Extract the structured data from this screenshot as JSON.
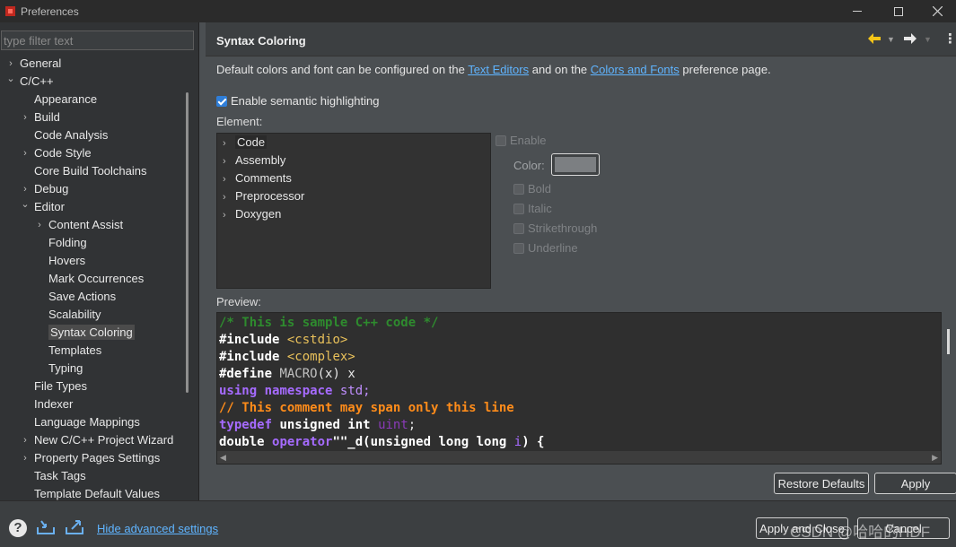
{
  "window": {
    "title": "Preferences"
  },
  "filter": {
    "placeholder": "type filter text"
  },
  "tree": [
    {
      "label": "General",
      "level": 0,
      "arrow": "right"
    },
    {
      "label": "C/C++",
      "level": 0,
      "arrow": "down"
    },
    {
      "label": "Appearance",
      "level": 1,
      "arrow": ""
    },
    {
      "label": "Build",
      "level": 1,
      "arrow": "right"
    },
    {
      "label": "Code Analysis",
      "level": 1,
      "arrow": ""
    },
    {
      "label": "Code Style",
      "level": 1,
      "arrow": "right"
    },
    {
      "label": "Core Build Toolchains",
      "level": 1,
      "arrow": ""
    },
    {
      "label": "Debug",
      "level": 1,
      "arrow": "right"
    },
    {
      "label": "Editor",
      "level": 1,
      "arrow": "down"
    },
    {
      "label": "Content Assist",
      "level": 2,
      "arrow": "right"
    },
    {
      "label": "Folding",
      "level": 2,
      "arrow": ""
    },
    {
      "label": "Hovers",
      "level": 2,
      "arrow": ""
    },
    {
      "label": "Mark Occurrences",
      "level": 2,
      "arrow": ""
    },
    {
      "label": "Save Actions",
      "level": 2,
      "arrow": ""
    },
    {
      "label": "Scalability",
      "level": 2,
      "arrow": ""
    },
    {
      "label": "Syntax Coloring",
      "level": 2,
      "arrow": "",
      "selected": true
    },
    {
      "label": "Templates",
      "level": 2,
      "arrow": ""
    },
    {
      "label": "Typing",
      "level": 2,
      "arrow": ""
    },
    {
      "label": "File Types",
      "level": 1,
      "arrow": ""
    },
    {
      "label": "Indexer",
      "level": 1,
      "arrow": ""
    },
    {
      "label": "Language Mappings",
      "level": 1,
      "arrow": ""
    },
    {
      "label": "New C/C++ Project Wizard",
      "level": 1,
      "arrow": "right"
    },
    {
      "label": "Property Pages Settings",
      "level": 1,
      "arrow": "right"
    },
    {
      "label": "Task Tags",
      "level": 1,
      "arrow": ""
    },
    {
      "label": "Template Default Values",
      "level": 1,
      "arrow": ""
    }
  ],
  "page": {
    "title": "Syntax Coloring",
    "desc_prefix": "Default colors and font can be configured on the ",
    "desc_link1": "Text Editors",
    "desc_mid": " and on the ",
    "desc_link2": "Colors and Fonts",
    "desc_suffix": " preference page.",
    "semantic_label": "Enable semantic highlighting",
    "semantic_checked": true,
    "element_label": "Element:",
    "elements": [
      "Code",
      "Assembly",
      "Comments",
      "Preprocessor",
      "Doxygen"
    ],
    "selected_element": "Code",
    "options": {
      "enable": "Enable",
      "color": "Color:",
      "bold": "Bold",
      "italic": "Italic",
      "strikethrough": "Strikethrough",
      "underline": "Underline"
    },
    "swatch_color": "#7c7f82",
    "preview_label": "Preview:",
    "preview": {
      "line1": "/* This is sample C++ code */",
      "line2_kw": "#include",
      "line2_val": "<cstdio>",
      "line3_kw": "#include",
      "line3_val": "<complex>",
      "line4_kw": "#define",
      "line4_macro": "MACRO",
      "line4_rest": "(x) x",
      "line5_kw1": "using",
      "line5_kw2": "namespace",
      "line5_rest": "std;",
      "line6": "// This comment may span only this line",
      "line7_kw": "typedef",
      "line7_type1": "unsigned",
      "line7_type2": "int",
      "line7_name": "uint",
      "line7_end": ";",
      "line8_t": "double",
      "line8_op": "operator",
      "line8_str": "\"\"_d(",
      "line8_t2": "unsigned long long",
      "line8_param": "i",
      "line8_end": ") {"
    },
    "restore_label": "Restore Defaults",
    "apply_label": "Apply"
  },
  "bottom": {
    "advanced_link": "Hide advanced settings",
    "apply_close_label": "Apply and Close",
    "cancel_label": "Cancel",
    "watermark": "CSDN @哈哈的HDF"
  },
  "colors": {
    "link": "#5fb4ff",
    "accent": "#2f7ed8",
    "arrow_yellow": "#f5c518"
  }
}
